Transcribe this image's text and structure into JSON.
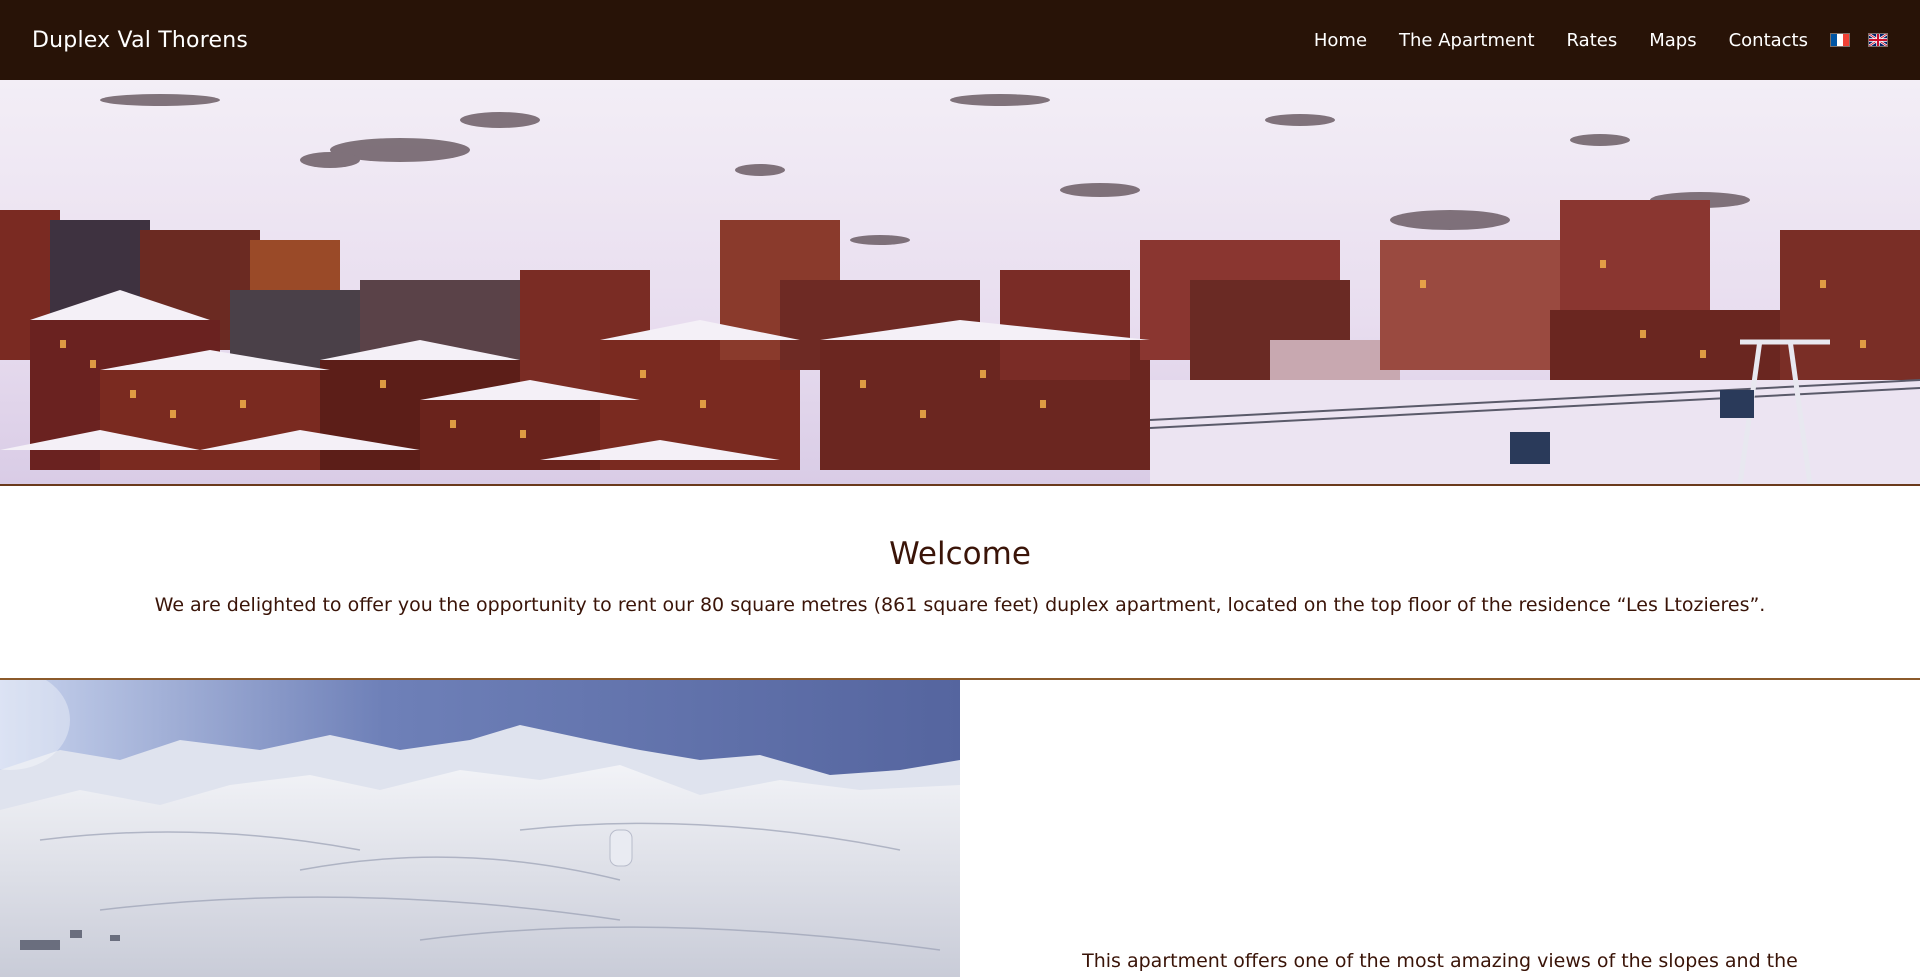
{
  "header": {
    "brand": "Duplex Val Thorens",
    "nav": [
      "Home",
      "The Apartment",
      "Rates",
      "Maps",
      "Contacts"
    ],
    "languages": [
      {
        "code": "fr",
        "icon": "french-flag-icon"
      },
      {
        "code": "en",
        "icon": "uk-flag-icon"
      }
    ],
    "background": "#281307"
  },
  "welcome": {
    "title": "Welcome",
    "text": "We are delighted to offer you the opportunity to rent our 80 square metres (861 square feet) duplex apartment, located on the top floor of the residence “Les Ltozieres”."
  },
  "lower": {
    "text": "This apartment offers one of the most amazing views of the slopes and the"
  },
  "colors": {
    "text": "#3a1408",
    "accent": "#8b5a2b"
  }
}
